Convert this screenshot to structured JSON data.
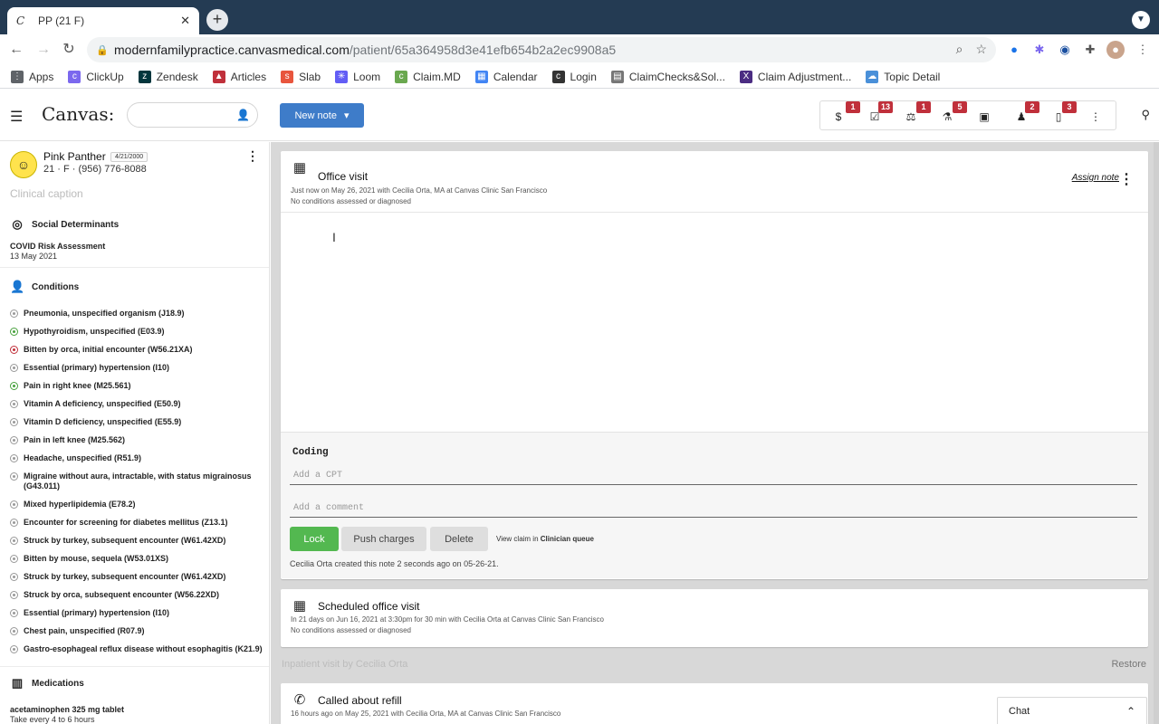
{
  "browser": {
    "tab_title": "PP (21 F)",
    "tab_favicon": "C",
    "url_host": "modernfamilypractice.canvasmedical.com",
    "url_path": "/patient/65a364958d3e41efb654b2a2ec9908a5",
    "bookmarks": [
      {
        "label": "Apps",
        "icon": "apps-grid-icon",
        "color": "#5f6368"
      },
      {
        "label": "ClickUp",
        "icon": "clickup-icon",
        "color": "#7b68ee"
      },
      {
        "label": "Zendesk",
        "icon": "zendesk-icon",
        "color": "#03363d"
      },
      {
        "label": "Articles",
        "icon": "articles-icon",
        "color": "#c0303b"
      },
      {
        "label": "Slab",
        "icon": "slab-icon",
        "color": "#e8553d"
      },
      {
        "label": "Loom",
        "icon": "loom-icon",
        "color": "#625df5"
      },
      {
        "label": "Claim.MD",
        "icon": "claimmd-icon",
        "color": "#6aa84f"
      },
      {
        "label": "Calendar",
        "icon": "calendar-icon",
        "color": "#4285f4"
      },
      {
        "label": "Login",
        "icon": "login-icon",
        "color": "#333333"
      },
      {
        "label": "ClaimChecks&Sol...",
        "icon": "claimchecks-icon",
        "color": "#777777"
      },
      {
        "label": "Claim Adjustment...",
        "icon": "claim-adjustment-icon",
        "color": "#4b2c82"
      },
      {
        "label": "Topic Detail",
        "icon": "cloud-icon",
        "color": "#4a90d9"
      }
    ]
  },
  "header": {
    "logo": "Canvas:",
    "new_note_label": "New note",
    "icon_badges": [
      {
        "icon": "billing-icon",
        "count": "1"
      },
      {
        "icon": "tasks-icon",
        "count": "13"
      },
      {
        "icon": "scale-icon",
        "count": "1"
      },
      {
        "icon": "lab-flask-icon",
        "count": "5"
      },
      {
        "icon": "imaging-icon",
        "count": ""
      },
      {
        "icon": "referral-person-icon",
        "count": "2"
      },
      {
        "icon": "document-icon",
        "count": "3"
      },
      {
        "icon": "more-icon",
        "count": ""
      }
    ]
  },
  "patient": {
    "name": "Pink Panther",
    "dob": "4/21/2000",
    "demographics": "21 · F · (956) 776-8088",
    "caption_placeholder": "Clinical caption"
  },
  "sidebar": {
    "social_determinants": {
      "title": "Social Determinants",
      "item_title": "COVID Risk Assessment",
      "item_date": "13 May 2021"
    },
    "conditions_title": "Conditions",
    "conditions": [
      {
        "label": "Pneumonia, unspecified organism (J18.9)",
        "status": "gray"
      },
      {
        "label": "Hypothyroidism, unspecified (E03.9)",
        "status": "green"
      },
      {
        "label": "Bitten by orca, initial encounter (W56.21XA)",
        "status": "red"
      },
      {
        "label": "Essential (primary) hypertension (I10)",
        "status": "gray"
      },
      {
        "label": "Pain in right knee (M25.561)",
        "status": "green"
      },
      {
        "label": "Vitamin A deficiency, unspecified (E50.9)",
        "status": "gray"
      },
      {
        "label": "Vitamin D deficiency, unspecified (E55.9)",
        "status": "gray"
      },
      {
        "label": "Pain in left knee (M25.562)",
        "status": "gray"
      },
      {
        "label": "Headache, unspecified (R51.9)",
        "status": "gray"
      },
      {
        "label": "Migraine without aura, intractable, with status migrainosus (G43.011)",
        "status": "gray"
      },
      {
        "label": "Mixed hyperlipidemia (E78.2)",
        "status": "gray"
      },
      {
        "label": "Encounter for screening for diabetes mellitus (Z13.1)",
        "status": "gray"
      },
      {
        "label": "Struck by turkey, subsequent encounter (W61.42XD)",
        "status": "gray"
      },
      {
        "label": "Bitten by mouse, sequela (W53.01XS)",
        "status": "gray"
      },
      {
        "label": "Struck by turkey, subsequent encounter (W61.42XD)",
        "status": "gray"
      },
      {
        "label": "Struck by orca, subsequent encounter (W56.22XD)",
        "status": "gray"
      },
      {
        "label": "Essential (primary) hypertension (I10)",
        "status": "gray"
      },
      {
        "label": "Chest pain, unspecified (R07.9)",
        "status": "gray"
      },
      {
        "label": "Gastro-esophageal reflux disease without esophagitis (K21.9)",
        "status": "gray"
      }
    ],
    "medications": {
      "title": "Medications",
      "item_title": "acetaminophen 325 mg tablet",
      "item_sig": "Take every 4 to 6 hours"
    }
  },
  "note": {
    "title": "Office visit",
    "subtitle": "Just now on May 26, 2021 with Cecilia Orta, MA at Canvas Clinic San Francisco",
    "conditions_text": "No conditions assessed or diagnosed",
    "assign_label": "Assign note",
    "coding_label": "Coding",
    "cpt_placeholder": "Add a CPT",
    "comment_placeholder": "Add a comment",
    "lock_label": "Lock",
    "push_label": "Push charges",
    "delete_label": "Delete",
    "view_claim_prefix": "View claim in",
    "view_claim_link": "Clinician queue",
    "created_text": "Cecilia Orta created this note 2 seconds ago on 05-26-21."
  },
  "scheduled": {
    "title": "Scheduled office visit",
    "subtitle": "In 21 days on Jun 16, 2021 at 3:30pm for 30 min with Cecilia Orta at Canvas Clinic San Francisco",
    "conditions_text": "No conditions assessed or diagnosed"
  },
  "inpatient": {
    "label": "Inpatient visit by Cecilia Orta",
    "restore_label": "Restore"
  },
  "refill": {
    "title": "Called about refill",
    "subtitle": "16 hours ago on May 25, 2021 with Cecilia Orta, MA at Canvas Clinic San Francisco"
  },
  "chat": {
    "label": "Chat"
  },
  "colors": {
    "brand_blue": "#3e7cc9",
    "lock_green": "#53b850",
    "badge_red": "#c0303b"
  }
}
